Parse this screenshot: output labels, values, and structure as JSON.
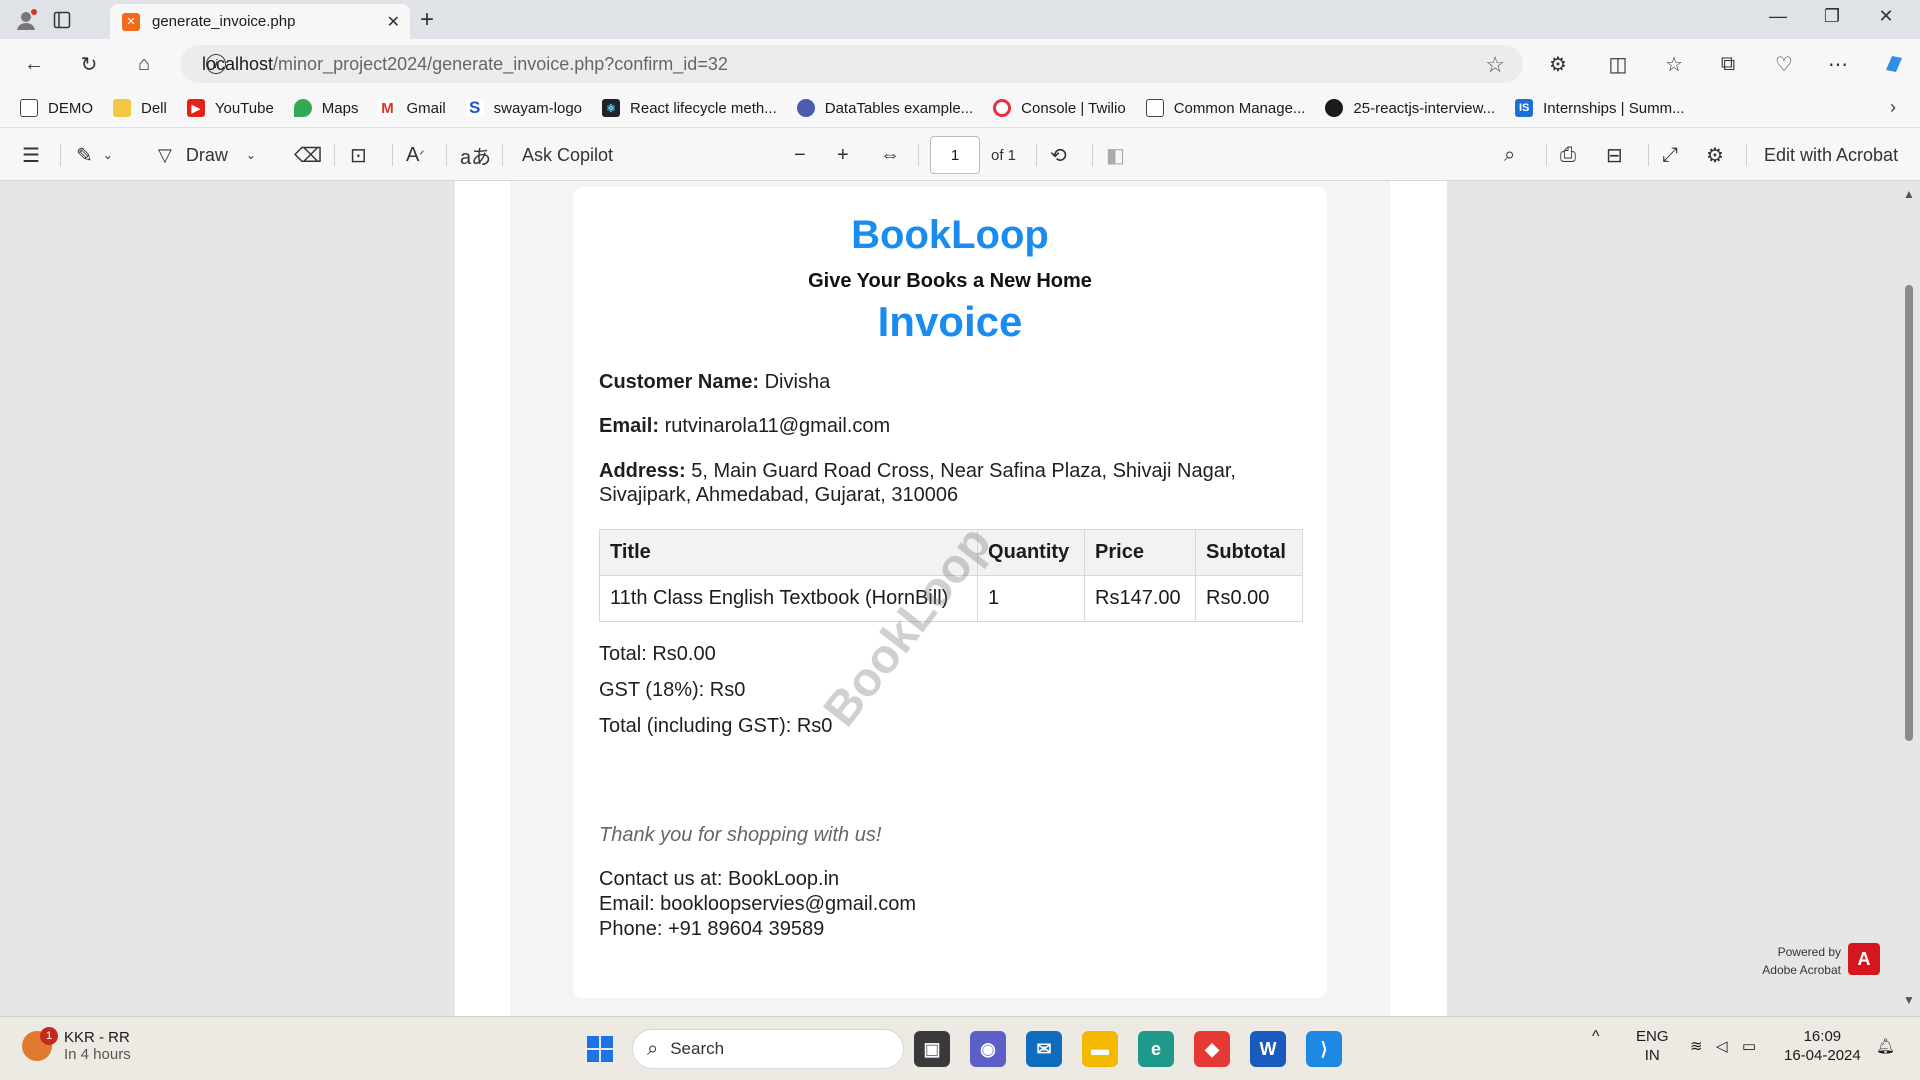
{
  "browser": {
    "tab_title": "generate_invoice.php",
    "url_host": "localhost",
    "url_path": "/minor_project2024/generate_invoice.php?confirm_id=32",
    "bookmarks": [
      "DEMO",
      "Dell",
      "YouTube",
      "Maps",
      "Gmail",
      "swayam-logo",
      "React lifecycle meth...",
      "DataTables example...",
      "Console | Twilio",
      "Common Manage...",
      "25-reactjs-interview...",
      "Internships | Summ..."
    ]
  },
  "pdf_toolbar": {
    "draw_label": "Draw",
    "ask_copilot_label": "Ask Copilot",
    "page_number": "1",
    "page_total": "of 1",
    "edit_label": "Edit with Acrobat"
  },
  "invoice": {
    "brand": "BookLoop",
    "tagline": "Give Your Books a New Home",
    "title": "Invoice",
    "customer_label": "Customer Name:",
    "customer_value": "Divisha",
    "email_label": "Email:",
    "email_value": "rutvinarola11@gmail.com",
    "address_label": "Address:",
    "address_value": "5, Main Guard Road Cross, Near Safina Plaza, Shivaji Nagar, Sivajipark, Ahmedabad, Gujarat, 310006",
    "table_headers": [
      "Title",
      "Quantity",
      "Price",
      "Subtotal"
    ],
    "items": [
      [
        "11th Class English Textbook (HornBill)",
        "1",
        "Rs147.00",
        "Rs0.00"
      ]
    ],
    "total": "Total: Rs0.00",
    "gst": "GST (18%): Rs0",
    "grand_total": "Total (including GST): Rs0",
    "thanks": "Thank you for shopping with us!",
    "contact_site": "Contact us at: BookLoop.in",
    "contact_email": "Email: bookloopservies@gmail.com",
    "contact_phone": "Phone: +91 89604 39589",
    "watermark": "BookLoop"
  },
  "powered_by": {
    "line1": "Powered by",
    "line2": "Adobe Acrobat"
  },
  "taskbar": {
    "weather_title": "KKR - RR",
    "weather_sub": "In 4 hours",
    "badge": "1",
    "search_label": "Search",
    "lang1": "ENG",
    "lang2": "IN",
    "time": "16:09",
    "date": "16-04-2024"
  },
  "colors": {
    "brand_blue": "#1a8cf0",
    "acrobat_red": "#d4171e"
  }
}
